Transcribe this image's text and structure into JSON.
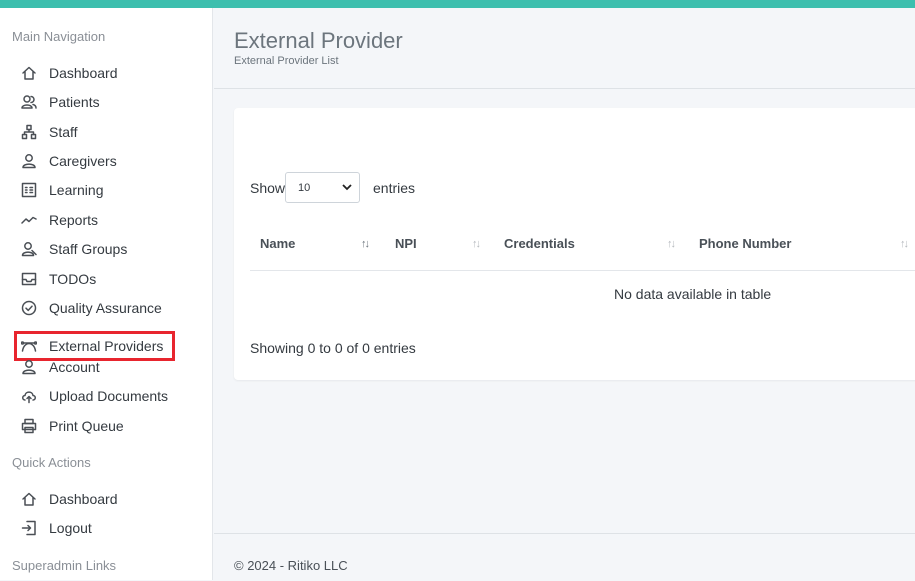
{
  "sidebar": {
    "main_heading": "Main Navigation",
    "main_items": [
      {
        "label": "Dashboard",
        "icon": "home-icon"
      },
      {
        "label": "Patients",
        "icon": "users-icon"
      },
      {
        "label": "Staff",
        "icon": "sitemap-icon"
      },
      {
        "label": "Caregivers",
        "icon": "user-icon"
      },
      {
        "label": "Learning",
        "icon": "list-icon"
      },
      {
        "label": "Reports",
        "icon": "chart-line-icon"
      },
      {
        "label": "Staff Groups",
        "icon": "user-group-icon"
      },
      {
        "label": "TODOs",
        "icon": "inbox-icon"
      },
      {
        "label": "Quality Assurance",
        "icon": "check-circle-icon"
      },
      {
        "label": "External Providers",
        "icon": "curve-icon",
        "active": true
      },
      {
        "label": "Account",
        "icon": "user-icon"
      },
      {
        "label": "Upload Documents",
        "icon": "cloud-upload-icon"
      },
      {
        "label": "Print Queue",
        "icon": "printer-icon"
      }
    ],
    "quick_heading": "Quick Actions",
    "quick_items": [
      {
        "label": "Dashboard",
        "icon": "home-icon"
      },
      {
        "label": "Logout",
        "icon": "logout-icon"
      }
    ],
    "superadmin_heading": "Superadmin Links"
  },
  "header": {
    "title": "External Provider",
    "subtitle": "External Provider List"
  },
  "table": {
    "show_label": "Show",
    "entries_value": "10",
    "entries_label": "entries",
    "columns": [
      "Name",
      "NPI",
      "Credentials",
      "Phone Number"
    ],
    "empty_message": "No data available in table",
    "info": "Showing 0 to 0 of 0 entries"
  },
  "footer": {
    "text": "© 2024 - Ritiko LLC"
  },
  "colors": {
    "accent": "#3dbfae",
    "highlight": "#e8252e"
  }
}
